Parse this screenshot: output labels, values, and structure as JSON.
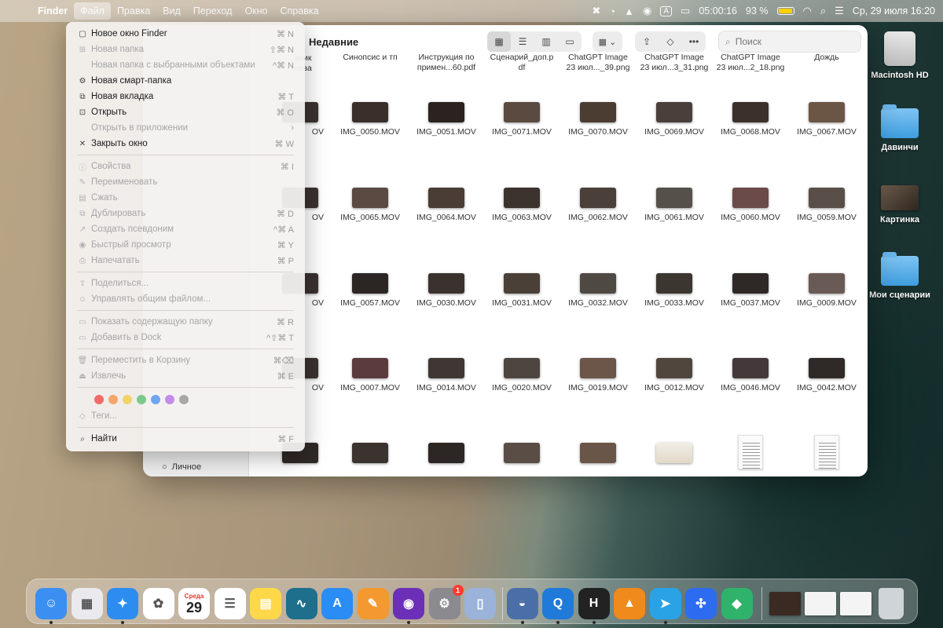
{
  "menubar": {
    "apple_icon": "",
    "items": [
      "Finder",
      "Файл",
      "Правка",
      "Вид",
      "Переход",
      "Окно",
      "Справка"
    ],
    "timer": "05:00:16",
    "battery": "93 %",
    "datetime": "Ср, 29 июля  16:20",
    "input_badge": "A"
  },
  "finder": {
    "title": "Недавние",
    "search_placeholder": "Поиск",
    "sidebar_item": "Личное",
    "partial_headers": [
      "...аник",
      "...нева"
    ],
    "header_files": [
      {
        "name": "Синопсис и тп",
        "sub": ""
      },
      {
        "name": "Инструкция по",
        "sub": "примен...60.pdf"
      },
      {
        "name": "Сценарий_доп.p",
        "sub": "df"
      },
      {
        "name": "ChatGPT Image",
        "sub": "23 июл..._39.png"
      },
      {
        "name": "ChatGPT Image",
        "sub": "23 июл...3_31.png"
      },
      {
        "name": "ChatGPT Image",
        "sub": "23 июл...2_18.png"
      },
      {
        "name": "Дождь",
        "sub": ""
      }
    ],
    "rows": [
      [
        "IMG_0050.MOV",
        "IMG_0051.MOV",
        "IMG_0071.MOV",
        "IMG_0070.MOV",
        "IMG_0069.MOV",
        "IMG_0068.MOV",
        "IMG_0067.MOV"
      ],
      [
        "IMG_0065.MOV",
        "IMG_0064.MOV",
        "IMG_0063.MOV",
        "IMG_0062.MOV",
        "IMG_0061.MOV",
        "IMG_0060.MOV",
        "IMG_0059.MOV"
      ],
      [
        "IMG_0057.MOV",
        "IMG_0030.MOV",
        "IMG_0031.MOV",
        "IMG_0032.MOV",
        "IMG_0033.MOV",
        "IMG_0037.MOV",
        "IMG_0009.MOV"
      ],
      [
        "IMG_0007.MOV",
        "IMG_0014.MOV",
        "IMG_0020.MOV",
        "IMG_0019.MOV",
        "IMG_0012.MOV",
        "IMG_0046.MOV",
        "IMG_0042.MOV"
      ]
    ],
    "partial_col_label": "OV"
  },
  "file_menu": {
    "groups": [
      [
        {
          "label": "Новое окно Finder",
          "shortcut": "⌘ N",
          "icon": "window-icon",
          "glyph": "▢",
          "enabled": true
        },
        {
          "label": "Новая папка",
          "shortcut": "⇧⌘ N",
          "icon": "folder-plus-icon",
          "glyph": "⊞",
          "enabled": false
        },
        {
          "label": "Новая папка с выбранными объектами",
          "shortcut": "^⌘ N",
          "icon": "",
          "glyph": "",
          "enabled": false
        },
        {
          "label": "Новая смарт-папка",
          "shortcut": "",
          "icon": "gear-icon",
          "glyph": "⚙",
          "enabled": true
        },
        {
          "label": "Новая вкладка",
          "shortcut": "⌘ T",
          "icon": "tab-icon",
          "glyph": "⧉",
          "enabled": true
        },
        {
          "label": "Открыть",
          "shortcut": "⌘ O",
          "icon": "open-icon",
          "glyph": "⊡",
          "enabled": true
        },
        {
          "label": "Открыть в приложении",
          "shortcut": "›",
          "icon": "",
          "glyph": "",
          "enabled": false
        },
        {
          "label": "Закрыть окно",
          "shortcut": "⌘ W",
          "icon": "close-icon",
          "glyph": "✕",
          "enabled": true
        }
      ],
      [
        {
          "label": "Свойства",
          "shortcut": "⌘ I",
          "icon": "info-icon",
          "glyph": "ⓘ",
          "enabled": false
        },
        {
          "label": "Переименовать",
          "shortcut": "",
          "icon": "pencil-icon",
          "glyph": "✎",
          "enabled": false
        },
        {
          "label": "Сжать",
          "shortcut": "",
          "icon": "archive-icon",
          "glyph": "▤",
          "enabled": false
        },
        {
          "label": "Дублировать",
          "shortcut": "⌘ D",
          "icon": "duplicate-icon",
          "glyph": "⧉",
          "enabled": false
        },
        {
          "label": "Создать псевдоним",
          "shortcut": "^⌘ A",
          "icon": "alias-icon",
          "glyph": "↗",
          "enabled": false
        },
        {
          "label": "Быстрый просмотр",
          "shortcut": "⌘ Y",
          "icon": "eye-icon",
          "glyph": "◉",
          "enabled": false
        },
        {
          "label": "Напечатать",
          "shortcut": "⌘ P",
          "icon": "printer-icon",
          "glyph": "⎙",
          "enabled": false
        }
      ],
      [
        {
          "label": "Поделиться...",
          "shortcut": "",
          "icon": "share-icon",
          "glyph": "⇪",
          "enabled": false
        },
        {
          "label": "Управлять общим файлом...",
          "shortcut": "",
          "icon": "people-icon",
          "glyph": "☺",
          "enabled": false
        }
      ],
      [
        {
          "label": "Показать содержащую папку",
          "shortcut": "⌘ R",
          "icon": "folder-icon",
          "glyph": "▭",
          "enabled": false
        },
        {
          "label": "Добавить в Dock",
          "shortcut": "^⇧⌘ T",
          "icon": "dock-icon",
          "glyph": "▭",
          "enabled": false
        }
      ],
      [
        {
          "label": "Переместить в Корзину",
          "shortcut": "⌘⌫",
          "icon": "trash-icon",
          "glyph": "🗑",
          "enabled": false
        },
        {
          "label": "Извлечь",
          "shortcut": "⌘ E",
          "icon": "eject-icon",
          "glyph": "⏏",
          "enabled": false
        }
      ]
    ],
    "tag_colors": [
      "#f26b6b",
      "#f5a66a",
      "#f2d36b",
      "#79c98a",
      "#6ea6f0",
      "#c48be8",
      "#a8a8a8"
    ],
    "tags_label": "Теги...",
    "find_label": "Найти",
    "find_shortcut": "⌘ F"
  },
  "desktop": {
    "icons": [
      {
        "label": "Macintosh HD",
        "kind": "drive"
      },
      {
        "label": "Давинчи",
        "kind": "folder"
      },
      {
        "label": "Картинка",
        "kind": "picture"
      },
      {
        "label": "Мои сценарии",
        "kind": "folder"
      }
    ]
  },
  "dock": {
    "calendar_month": "Среда",
    "calendar_day": "29",
    "settings_badge": "1",
    "apps": [
      {
        "name": "finder-icon",
        "color": "#3a8ff0",
        "glyph": "☺",
        "running": true
      },
      {
        "name": "launchpad-icon",
        "color": "#e9e9ee",
        "glyph": "▦",
        "running": false
      },
      {
        "name": "safari-icon",
        "color": "#2d8cf0",
        "glyph": "✦",
        "running": true
      },
      {
        "name": "photos-icon",
        "color": "#ffffff",
        "glyph": "✿",
        "running": false
      },
      {
        "name": "calendar-icon",
        "color": "#ffffff",
        "glyph": "",
        "running": false
      },
      {
        "name": "reminders-icon",
        "color": "#ffffff",
        "glyph": "☰",
        "running": false
      },
      {
        "name": "notes-icon",
        "color": "#ffd84a",
        "glyph": "▤",
        "running": false
      },
      {
        "name": "freeform-icon",
        "color": "#1d6f8c",
        "glyph": "∿",
        "running": false
      },
      {
        "name": "app-store-icon",
        "color": "#2a8cf5",
        "glyph": "A",
        "running": false
      },
      {
        "name": "pages-icon",
        "color": "#f3992f",
        "glyph": "✎",
        "running": false
      },
      {
        "name": "firefox-icon",
        "color": "#6b2fb8",
        "glyph": "◉",
        "running": true
      },
      {
        "name": "settings-icon",
        "color": "#8a8a8f",
        "glyph": "⚙",
        "running": false
      },
      {
        "name": "ipad-icon",
        "color": "#9bb3d9",
        "glyph": "▯",
        "running": false
      },
      {
        "name": "robot-icon",
        "color": "#4a6fa8",
        "glyph": "◒",
        "running": true
      },
      {
        "name": "quicktime-icon",
        "color": "#1f7ad9",
        "glyph": "Q",
        "running": true
      },
      {
        "name": "hype-icon",
        "color": "#222222",
        "glyph": "H",
        "running": true
      },
      {
        "name": "vlc-icon",
        "color": "#f08a1c",
        "glyph": "▲",
        "running": false
      },
      {
        "name": "telegram-icon",
        "color": "#2aa3e6",
        "glyph": "➤",
        "running": true
      },
      {
        "name": "xcode-tools-icon",
        "color": "#2d6cf0",
        "glyph": "✣",
        "running": false
      },
      {
        "name": "green-app-icon",
        "color": "#2fb36b",
        "glyph": "◆",
        "running": false
      }
    ],
    "docs": [
      {
        "name": "document-thumb-icon",
        "color": "#3a2a22"
      },
      {
        "name": "document-thumb-icon",
        "color": "#f4f4f4"
      },
      {
        "name": "document-thumb-icon",
        "color": "#f4f4f4"
      }
    ],
    "trash": {
      "name": "trash-dock-icon",
      "color": "#cfd4d8"
    }
  }
}
